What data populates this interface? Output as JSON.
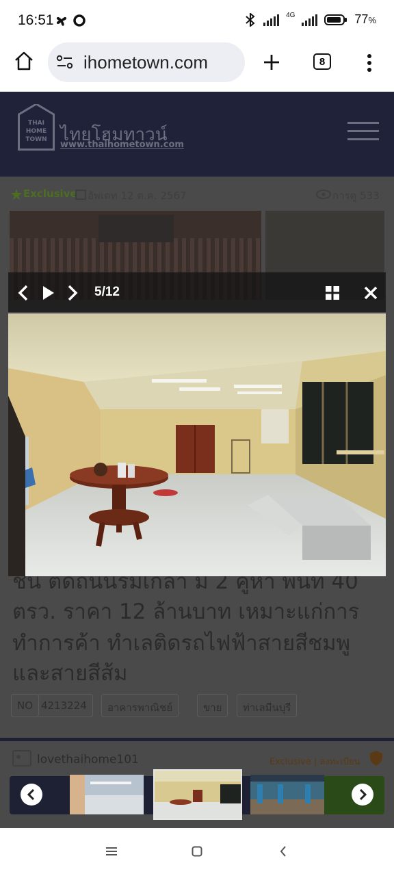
{
  "status_bar": {
    "time": "16:51",
    "network": "4G",
    "battery": "77",
    "battery_unit": "%"
  },
  "browser": {
    "url": "ihometown.com",
    "tab_count": "8"
  },
  "site": {
    "logo_thai": "ไทยโฮมทาวน์",
    "logo_url": "www.thaihometown.com",
    "logo_mark": "THAI HOME TOWN",
    "exclusive_label": "Exclusive",
    "updated_label": "อัพเดท 12 ต.ค. 2567",
    "views_label": "การดู 533",
    "title_lines": [
      "ชั้น ติดถนนริมเกล้า ม 2 คูหา พื้นที่ 40",
      "ตรว. ราคา 12 ล้านบาท เหมาะแก่การ",
      "ทำการค้า ทำเลติดรถไฟฟ้าสายสีชมพู",
      "และสายสีส้ม"
    ],
    "tags": [
      "NO",
      "4213224",
      "อาคารพาณิชย์",
      "ขาย",
      "ท่าเลมีนบุรี"
    ],
    "poster": "lovethaihome101",
    "poster_badge": "Exclusive | ลงทะเบียน"
  },
  "lightbox": {
    "counter": "5/12",
    "current_index": 5,
    "total": 12
  },
  "colors": {
    "header_navy": "#20223a",
    "overlay_dark": "#4a4a4a",
    "accent_green": "#6b9b3a"
  }
}
